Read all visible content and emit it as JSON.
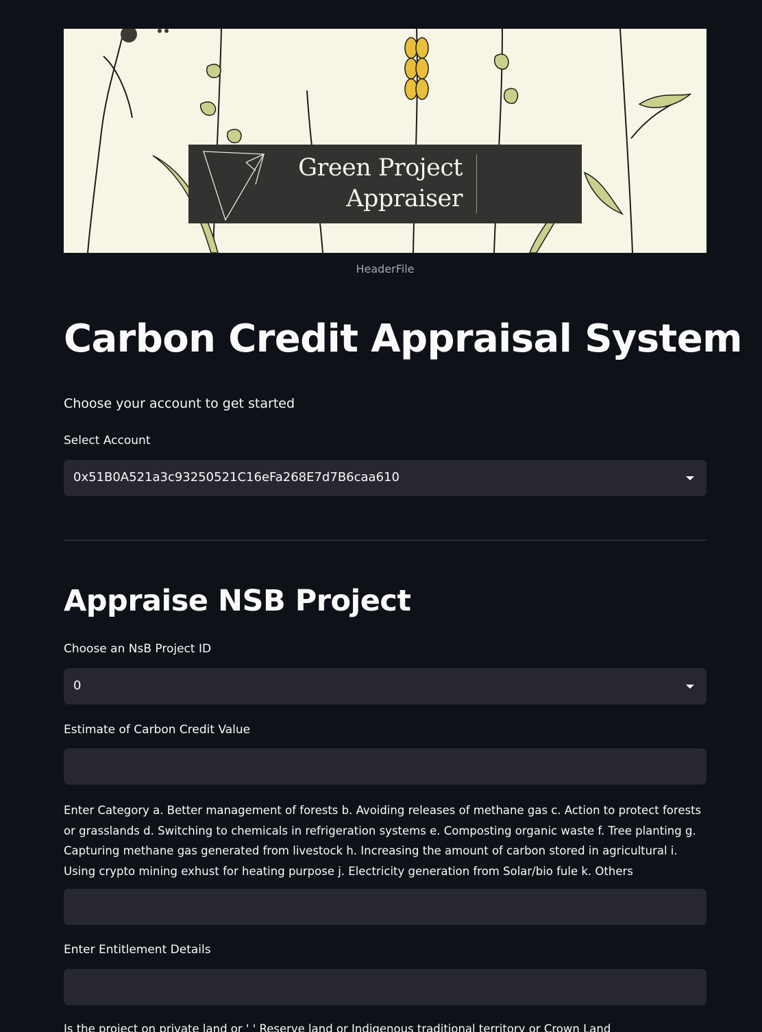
{
  "banner": {
    "title": "Green Project Appraiser",
    "caption": "HeaderFile"
  },
  "page_title": "Carbon Credit Appraisal System",
  "intro": "Choose your account to get started",
  "account": {
    "label": "Select Account",
    "value": "0x51B0A521a3c93250521C16eFa268E7d7B6caa610"
  },
  "section": {
    "title": "Appraise NSB Project"
  },
  "project_id": {
    "label": "Choose an NsB Project ID",
    "value": "0"
  },
  "estimate": {
    "label": "Estimate of Carbon Credit Value",
    "value": ""
  },
  "category": {
    "label": "Enter Category a. Better management of forests b. Avoiding releases of methane gas c. Action to protect forests or grasslands d. Switching to chemicals in refrigeration systems e. Composting organic waste f. Tree planting g. Capturing methane gas generated from livestock h. Increasing the amount of carbon stored in agricultural i. Using crypto mining exhust for heating purpose j. Electricity generation from Solar/bio fule k. Others",
    "value": ""
  },
  "entitlement": {
    "label": "Enter Entitlement Details",
    "value": ""
  },
  "land_question": {
    "label": "Is the project on private land or ' ' Reserve land or Indigenous traditional territory or Crown Land"
  }
}
